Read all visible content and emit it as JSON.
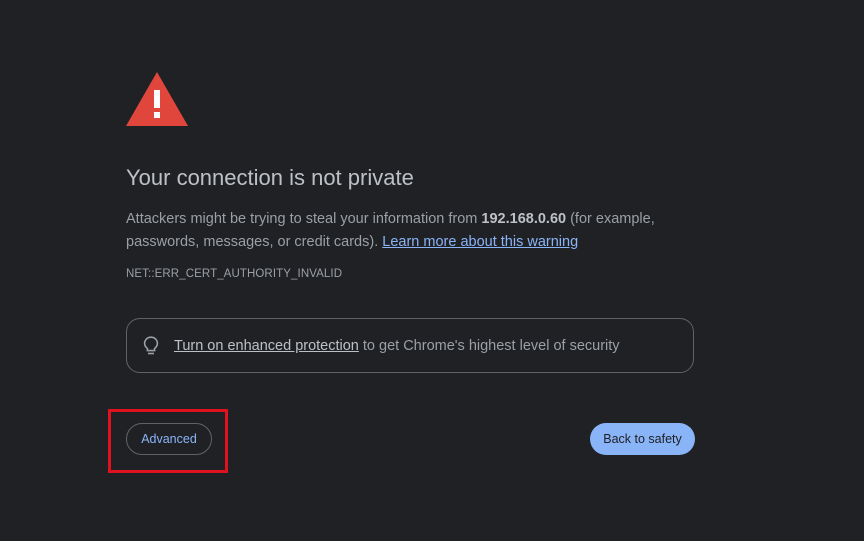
{
  "header": {
    "icon": "warning-triangle-icon",
    "title": "Your connection is not private"
  },
  "message": {
    "text_before": "Attackers might be trying to steal your information from ",
    "host": "192.168.0.60",
    "text_after": " (for example, passwords, messages, or credit cards). ",
    "learn_more_link": "Learn more about this warning"
  },
  "error_code": "NET::ERR_CERT_AUTHORITY_INVALID",
  "enhanced_protection": {
    "icon": "lightbulb-icon",
    "link_label": "Turn on enhanced protection",
    "text": " to get Chrome's highest level of security"
  },
  "buttons": {
    "advanced_label": "Advanced",
    "back_label": "Back to safety"
  },
  "colors": {
    "background": "#202124",
    "warning_red": "#e0463b",
    "accent_blue": "#8ab4f8",
    "highlight_red": "#e0121f"
  }
}
